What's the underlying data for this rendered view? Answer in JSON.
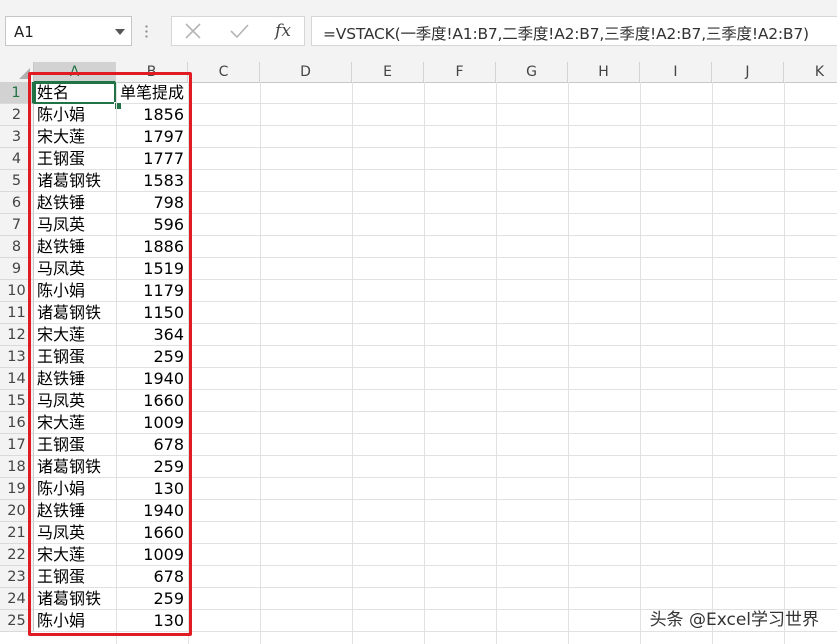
{
  "formula_bar": {
    "name_box": "A1",
    "insert_function_label": "fx",
    "formula": "=VSTACK(一季度!A1:B7,二季度!A2:B7,三季度!A2:B7,三季度!A2:B7)"
  },
  "columns": [
    "A",
    "B",
    "C",
    "D",
    "E",
    "F",
    "G",
    "H",
    "I",
    "J",
    "K"
  ],
  "rows": [
    "1",
    "2",
    "3",
    "4",
    "5",
    "6",
    "7",
    "8",
    "9",
    "10",
    "11",
    "12",
    "13",
    "14",
    "15",
    "16",
    "17",
    "18",
    "19",
    "20",
    "21",
    "22",
    "23",
    "24",
    "25"
  ],
  "data": [
    [
      "姓名",
      "单笔提成"
    ],
    [
      "陈小娟",
      "1856"
    ],
    [
      "宋大莲",
      "1797"
    ],
    [
      "王钢蛋",
      "1777"
    ],
    [
      "诸葛钢铁",
      "1583"
    ],
    [
      "赵铁锤",
      "798"
    ],
    [
      "马凤英",
      "596"
    ],
    [
      "赵铁锤",
      "1886"
    ],
    [
      "马凤英",
      "1519"
    ],
    [
      "陈小娟",
      "1179"
    ],
    [
      "诸葛钢铁",
      "1150"
    ],
    [
      "宋大莲",
      "364"
    ],
    [
      "王钢蛋",
      "259"
    ],
    [
      "赵铁锤",
      "1940"
    ],
    [
      "马凤英",
      "1660"
    ],
    [
      "宋大莲",
      "1009"
    ],
    [
      "王钢蛋",
      "678"
    ],
    [
      "诸葛钢铁",
      "259"
    ],
    [
      "陈小娟",
      "130"
    ],
    [
      "赵铁锤",
      "1940"
    ],
    [
      "马凤英",
      "1660"
    ],
    [
      "宋大莲",
      "1009"
    ],
    [
      "王钢蛋",
      "678"
    ],
    [
      "诸葛钢铁",
      "259"
    ],
    [
      "陈小娟",
      "130"
    ]
  ],
  "watermark": "头条 @Excel学习世界",
  "colors": {
    "accent": "#217346",
    "highlight_frame": "#e01b24"
  },
  "icons": [
    "dropdown-arrow-icon",
    "grip-icon",
    "cancel-icon",
    "enter-icon",
    "fx-icon",
    "select-all-icon"
  ]
}
